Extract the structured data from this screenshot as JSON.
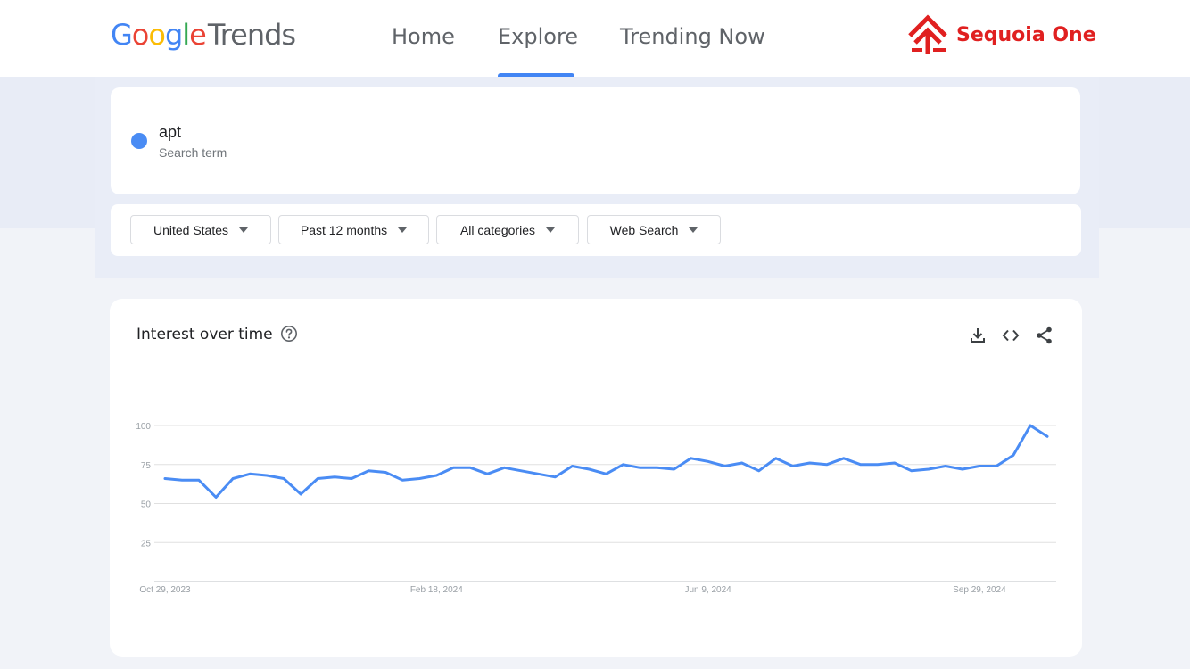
{
  "header": {
    "logo_google": [
      "G",
      "o",
      "o",
      "g",
      "l",
      "e"
    ],
    "logo_trends": "Trends",
    "nav": {
      "home": "Home",
      "explore": "Explore",
      "trending": "Trending Now"
    },
    "active_nav": "Explore",
    "brand_name": "Sequoia One",
    "brand_color": "#e02020",
    "accent_color": "#4285f4"
  },
  "search": {
    "term": "apt",
    "term_type": "Search term",
    "term_color": "#4a8cf4"
  },
  "filters": {
    "region": "United States",
    "time": "Past 12 months",
    "category": "All categories",
    "property": "Web Search"
  },
  "chart_panel": {
    "title": "Interest over time",
    "icons": [
      "help-icon",
      "download-icon",
      "embed-code-icon",
      "share-icon"
    ]
  },
  "chart_data": {
    "type": "line",
    "title": "Interest over time",
    "xlabel": "",
    "ylabel": "",
    "ylim": [
      0,
      100
    ],
    "yticks": [
      "100",
      "75",
      "50",
      "25"
    ],
    "xticks": [
      "Oct 29, 2023",
      "Feb 18, 2024",
      "Jun 9, 2024",
      "Sep 29, 2024"
    ],
    "x": [
      "2023-10-29",
      "2023-11-05",
      "2023-11-12",
      "2023-11-19",
      "2023-11-26",
      "2023-12-03",
      "2023-12-10",
      "2023-12-17",
      "2023-12-24",
      "2023-12-31",
      "2024-01-07",
      "2024-01-14",
      "2024-01-21",
      "2024-01-28",
      "2024-02-04",
      "2024-02-11",
      "2024-02-18",
      "2024-02-25",
      "2024-03-03",
      "2024-03-10",
      "2024-03-17",
      "2024-03-24",
      "2024-03-31",
      "2024-04-07",
      "2024-04-14",
      "2024-04-21",
      "2024-04-28",
      "2024-05-05",
      "2024-05-12",
      "2024-05-19",
      "2024-05-26",
      "2024-06-02",
      "2024-06-09",
      "2024-06-16",
      "2024-06-23",
      "2024-06-30",
      "2024-07-07",
      "2024-07-14",
      "2024-07-21",
      "2024-07-28",
      "2024-08-04",
      "2024-08-11",
      "2024-08-18",
      "2024-08-25",
      "2024-09-01",
      "2024-09-08",
      "2024-09-15",
      "2024-09-22",
      "2024-09-29",
      "2024-10-06",
      "2024-10-13",
      "2024-10-20",
      "2024-10-27",
      "2024-11-03",
      "2024-11-10"
    ],
    "series": [
      {
        "color": "#4a8cf4",
        "values": [
          66,
          65,
          65,
          54,
          66,
          69,
          68,
          66,
          56,
          66,
          67,
          66,
          71,
          70,
          65,
          66,
          68,
          73,
          73,
          69,
          73,
          71,
          69,
          67,
          74,
          72,
          69,
          75,
          73,
          73,
          72,
          79,
          77,
          74,
          76,
          71,
          79,
          74,
          76,
          75,
          79,
          75,
          75,
          76,
          71,
          72,
          74,
          72,
          74,
          74,
          81,
          100,
          93
        ]
      }
    ],
    "grid": true
  }
}
